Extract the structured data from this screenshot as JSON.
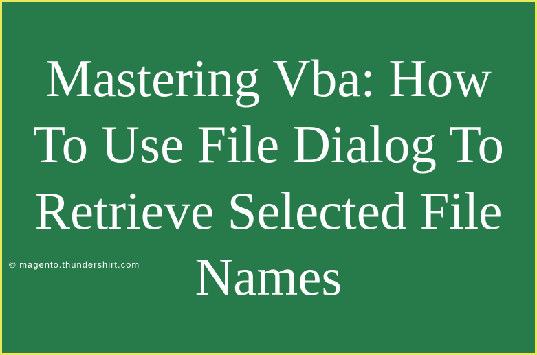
{
  "title": "Mastering Vba: How To Use File Dialog To Retrieve Selected File Names",
  "watermark": "© magento.thundershirt.com"
}
